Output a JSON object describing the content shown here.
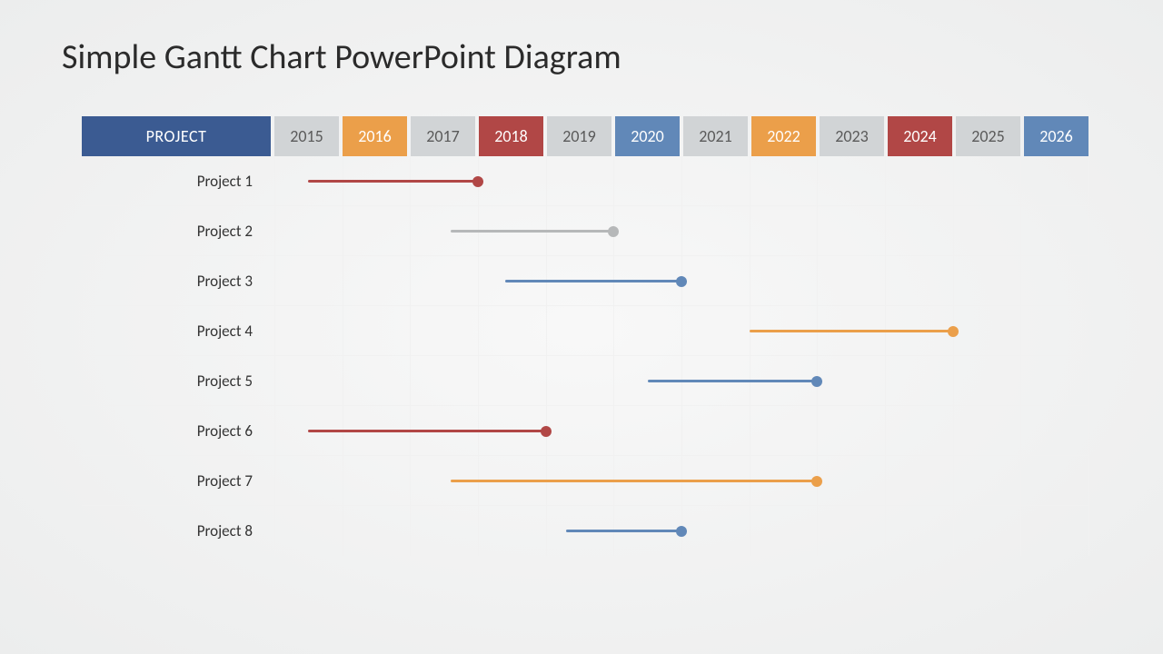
{
  "title": "Simple Gantt Chart PowerPoint Diagram",
  "header": {
    "project_label": "PROJECT",
    "years": [
      {
        "label": "2015",
        "bg": "#d1d4d6",
        "white": false
      },
      {
        "label": "2016",
        "bg": "#eb9f4a",
        "white": true
      },
      {
        "label": "2017",
        "bg": "#d1d4d6",
        "white": false
      },
      {
        "label": "2018",
        "bg": "#b14746",
        "white": true
      },
      {
        "label": "2019",
        "bg": "#d1d4d6",
        "white": false
      },
      {
        "label": "2020",
        "bg": "#6188b8",
        "white": true
      },
      {
        "label": "2021",
        "bg": "#d1d4d6",
        "white": false
      },
      {
        "label": "2022",
        "bg": "#eb9f4a",
        "white": true
      },
      {
        "label": "2023",
        "bg": "#d1d4d6",
        "white": false
      },
      {
        "label": "2024",
        "bg": "#b14746",
        "white": true
      },
      {
        "label": "2025",
        "bg": "#d1d4d6",
        "white": false
      },
      {
        "label": "2026",
        "bg": "#6188b8",
        "white": true
      }
    ]
  },
  "projects": [
    {
      "label": "Project 1"
    },
    {
      "label": "Project 2"
    },
    {
      "label": "Project 3"
    },
    {
      "label": "Project 4"
    },
    {
      "label": "Project 5"
    },
    {
      "label": "Project 6"
    },
    {
      "label": "Project 7"
    },
    {
      "label": "Project 8"
    }
  ],
  "chart_data": {
    "type": "gantt",
    "title": "Simple Gantt Chart PowerPoint Diagram",
    "x_axis": "year",
    "x_range": [
      2015,
      2026
    ],
    "tasks": [
      {
        "name": "Project 1",
        "start": 2015.5,
        "end": 2018.0,
        "color": "#b14746"
      },
      {
        "name": "Project 2",
        "start": 2017.6,
        "end": 2020.0,
        "color": "#b6b8b9"
      },
      {
        "name": "Project 3",
        "start": 2018.4,
        "end": 2021.0,
        "color": "#6188b8"
      },
      {
        "name": "Project 4",
        "start": 2022.0,
        "end": 2025.0,
        "color": "#eb9f4a"
      },
      {
        "name": "Project 5",
        "start": 2020.5,
        "end": 2023.0,
        "color": "#6188b8"
      },
      {
        "name": "Project 6",
        "start": 2015.5,
        "end": 2019.0,
        "color": "#b14746"
      },
      {
        "name": "Project 7",
        "start": 2017.6,
        "end": 2023.0,
        "color": "#eb9f4a"
      },
      {
        "name": "Project 8",
        "start": 2019.3,
        "end": 2021.0,
        "color": "#6188b8"
      }
    ]
  }
}
